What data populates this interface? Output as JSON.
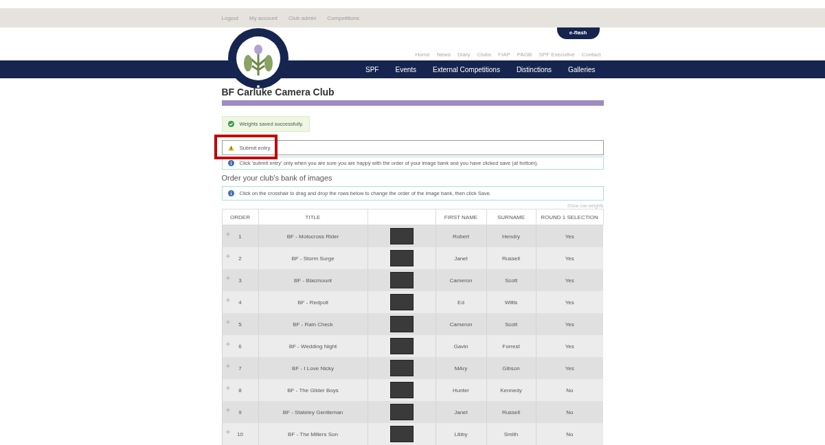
{
  "top_bar": {
    "links": [
      "Logout",
      "My account",
      "Club admin",
      "Competitions"
    ]
  },
  "header": {
    "eflash": "e-flash",
    "secondary_nav": [
      "Home",
      "News",
      "Diary",
      "Clubs",
      "FIAP",
      "PAGB",
      "SPF Executive",
      "Contact"
    ],
    "main_nav": [
      "SPF",
      "Events",
      "External Competitions",
      "Distinctions",
      "Galleries"
    ]
  },
  "page_title": "BF Carluke Camera Club",
  "success_alert": "Weights saved successfully.",
  "submit_entry": {
    "label": "Submit entry",
    "highlighted": true
  },
  "submit_info": "Click 'submit entry' only when you are sure you are happy with the order of your image bank and you have clicked save (at bottom).",
  "section_heading": "Order your club's bank of images",
  "order_info": "Click on the crosshair to drag and drop the rows below to change the order of the image bank, then click Save.",
  "show_row_weights": "Show row weights",
  "table": {
    "columns": [
      "ORDER",
      "TITLE",
      "FIRST NAME",
      "SURNAME",
      "ROUND 1 SELECTION"
    ],
    "rows": [
      {
        "order": "1",
        "title": "BF - Motocross Rider",
        "first_name": "Robert",
        "surname": "Hendry",
        "selection": "Yes"
      },
      {
        "order": "2",
        "title": "BF - Storm Surge",
        "first_name": "Janet",
        "surname": "Russell",
        "selection": "Yes"
      },
      {
        "order": "3",
        "title": "BF - Blacmount",
        "first_name": "Cameron",
        "surname": "Scott",
        "selection": "Yes"
      },
      {
        "order": "4",
        "title": "BF - Redpoll",
        "first_name": "Ed",
        "surname": "Willis",
        "selection": "Yes"
      },
      {
        "order": "5",
        "title": "BF - Rain Check",
        "first_name": "Cameron",
        "surname": "Scott",
        "selection": "Yes"
      },
      {
        "order": "6",
        "title": "BF - Wedding Night",
        "first_name": "Gavin",
        "surname": "Forrest",
        "selection": "Yes"
      },
      {
        "order": "7",
        "title": "BF - I Love Nicky",
        "first_name": "MAry",
        "surname": "Gibson",
        "selection": "Yes"
      },
      {
        "order": "8",
        "title": "BF - The Glider Boys",
        "first_name": "Hunter",
        "surname": "Kennedy",
        "selection": "No"
      },
      {
        "order": "9",
        "title": "BF - Stateley Gentleman",
        "first_name": "Janet",
        "surname": "Russell",
        "selection": "No"
      },
      {
        "order": "10",
        "title": "BF - The Millers Son",
        "first_name": "Libby",
        "surname": "Smith",
        "selection": "No"
      }
    ]
  }
}
